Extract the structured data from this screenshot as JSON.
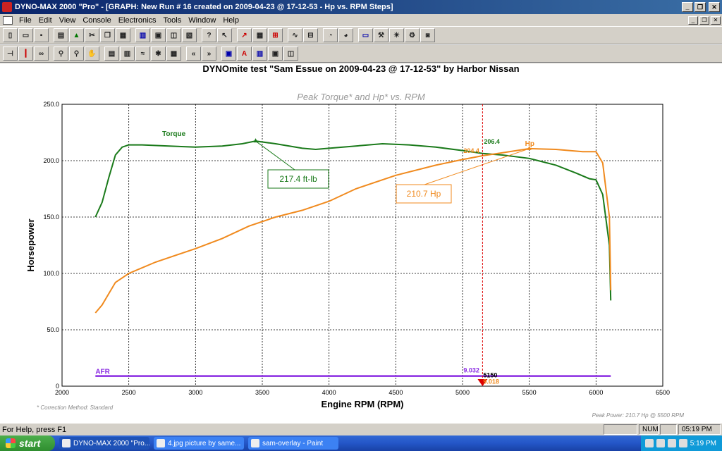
{
  "window": {
    "title": "DYNO-MAX 2000 \"Pro\" - [GRAPH: New Run # 16 created on 2009-04-23 @ 17-12-53 - Hp vs. RPM Steps]"
  },
  "menu": [
    "File",
    "Edit",
    "View",
    "Console",
    "Electronics",
    "Tools",
    "Window",
    "Help"
  ],
  "graph": {
    "title": "DYNOmite test \"Sam Essue on 2009-04-23 @ 17-12-53\" by Harbor Nissan",
    "subtitle": "Peak Torque* and Hp* vs. RPM",
    "footnote_left": "* Correction Method: Standard",
    "footnote_right": "Peak Power: 210.7 Hp @ 5500 RPM"
  },
  "chart_data": {
    "type": "line",
    "xlabel": "Engine RPM (RPM)",
    "ylabel": "Horsepower",
    "xlim": [
      2000,
      6500
    ],
    "ylim": [
      0,
      250
    ],
    "x_ticks": [
      "2000",
      "2500",
      "3000",
      "3500",
      "4000",
      "4500",
      "5000",
      "5500",
      "6000",
      "6500"
    ],
    "y_ticks": [
      "0",
      "50.0",
      "100.0",
      "150.0",
      "200.0",
      "250.0"
    ],
    "grid": true,
    "series": [
      {
        "name": "Torque",
        "color": "#1a7a1a",
        "points": [
          [
            2250,
            150
          ],
          [
            2300,
            163
          ],
          [
            2350,
            185
          ],
          [
            2400,
            205
          ],
          [
            2450,
            212
          ],
          [
            2500,
            214
          ],
          [
            2600,
            214
          ],
          [
            2800,
            213
          ],
          [
            3000,
            212
          ],
          [
            3200,
            213
          ],
          [
            3350,
            215
          ],
          [
            3450,
            217.4
          ],
          [
            3600,
            215
          ],
          [
            3800,
            211
          ],
          [
            3900,
            210
          ],
          [
            4000,
            211
          ],
          [
            4200,
            213
          ],
          [
            4400,
            215
          ],
          [
            4600,
            214
          ],
          [
            4800,
            212
          ],
          [
            5000,
            209
          ],
          [
            5150,
            206.4
          ],
          [
            5300,
            205
          ],
          [
            5500,
            202
          ],
          [
            5700,
            196
          ],
          [
            5850,
            189
          ],
          [
            5950,
            184
          ],
          [
            6000,
            183
          ],
          [
            6050,
            170
          ],
          [
            6100,
            125
          ],
          [
            6110,
            76
          ]
        ]
      },
      {
        "name": "Hp",
        "color": "#f08a1e",
        "points": [
          [
            2250,
            65
          ],
          [
            2300,
            72
          ],
          [
            2400,
            92
          ],
          [
            2500,
            100
          ],
          [
            2700,
            110
          ],
          [
            3000,
            122
          ],
          [
            3200,
            131
          ],
          [
            3400,
            142
          ],
          [
            3600,
            150
          ],
          [
            3800,
            156
          ],
          [
            4000,
            164
          ],
          [
            4200,
            175
          ],
          [
            4500,
            187
          ],
          [
            4800,
            196
          ],
          [
            5000,
            201
          ],
          [
            5150,
            204.4
          ],
          [
            5300,
            207
          ],
          [
            5500,
            210.7
          ],
          [
            5700,
            210
          ],
          [
            5900,
            208
          ],
          [
            6000,
            208
          ],
          [
            6050,
            198
          ],
          [
            6100,
            150
          ],
          [
            6110,
            85
          ]
        ]
      },
      {
        "name": "AFR",
        "color": "#8a2be2",
        "points": [
          [
            2250,
            9
          ],
          [
            6110,
            9
          ]
        ]
      }
    ],
    "annotations": [
      {
        "text": "217.4 ft-lb",
        "series": "Torque",
        "x": 3450,
        "y": 217.4
      },
      {
        "text": "210.7 Hp",
        "series": "Hp",
        "x": 5500,
        "y": 210.7
      }
    ],
    "cursor": {
      "rpm_label": "5150",
      "torque_label": "206.4",
      "hp_label": "204.4",
      "afr_label": "9.032",
      "afr2_label": "9.018"
    }
  },
  "status": {
    "help": "For Help, press F1",
    "num": "NUM",
    "time": "05:19 PM"
  },
  "taskbar": {
    "start": "start",
    "tasks": [
      "DYNO-MAX 2000 \"Pro...",
      "4.jpg picture by same...",
      "sam-overlay - Paint"
    ],
    "clock": "5:19 PM"
  }
}
